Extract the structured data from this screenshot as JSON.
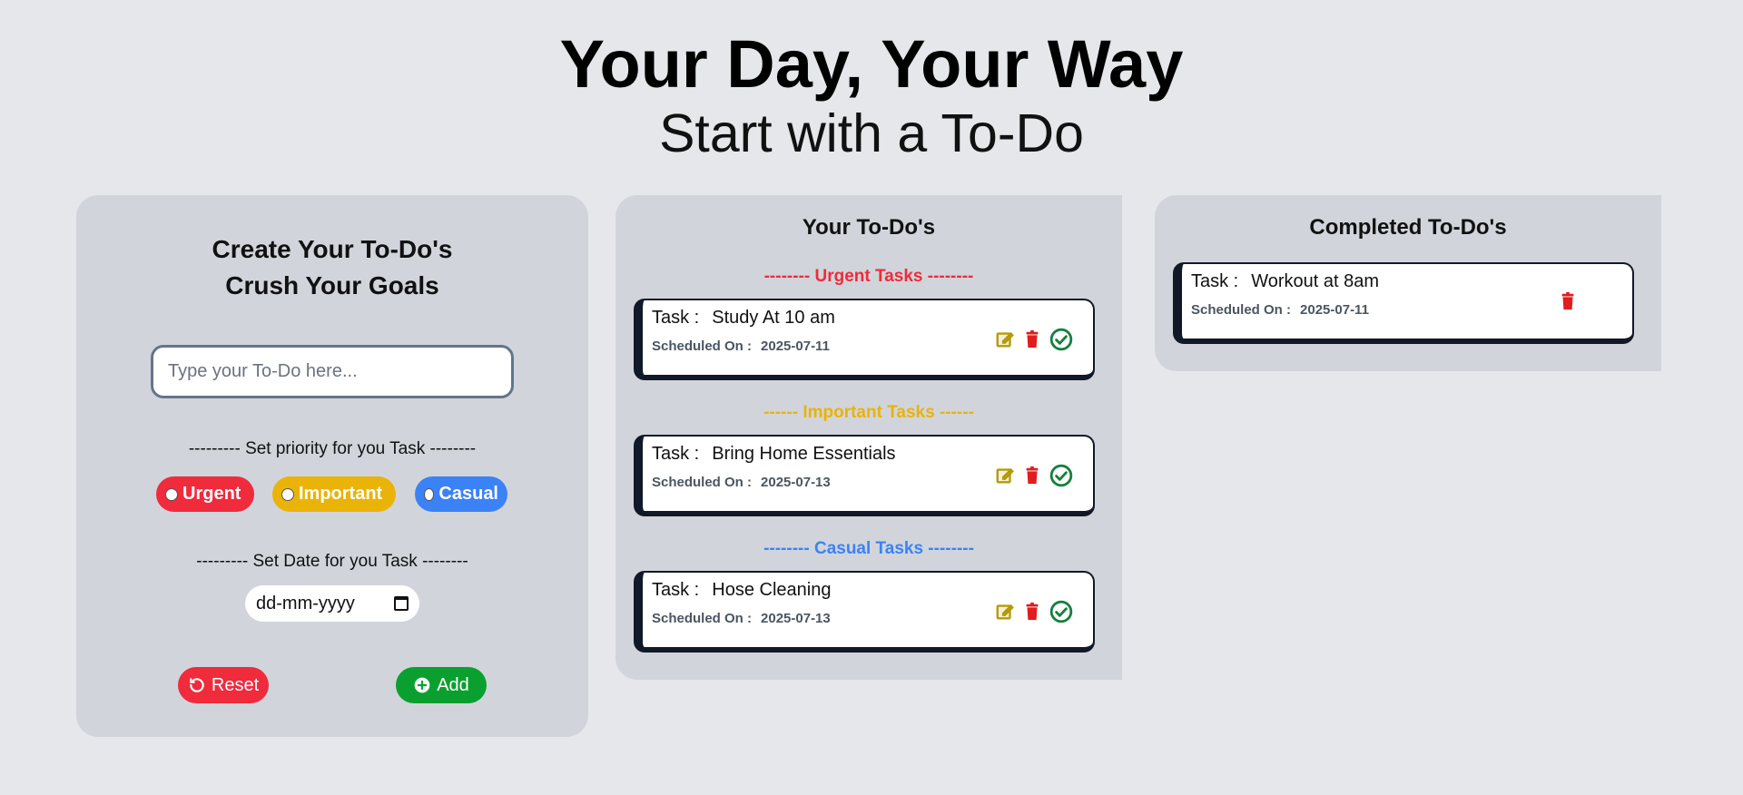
{
  "header": {
    "title": "Your Day, Your Way",
    "subtitle": "Start with a To-Do"
  },
  "create": {
    "heading_line1": "Create Your To-Do's",
    "heading_line2": "Crush Your Goals",
    "input_placeholder": "Type your To-Do here...",
    "priority_label": "--------- Set priority for you Task --------",
    "priorities": [
      "Urgent",
      "Important",
      "Casual"
    ],
    "date_label": "--------- Set Date for you Task --------",
    "date_placeholder": "dd-mm-yyyy",
    "reset_label": "Reset",
    "add_label": "Add"
  },
  "todos": {
    "title": "Your To-Do's",
    "task_label": "Task :",
    "sched_label": "Scheduled On :",
    "urgent_label": "-------- Urgent Tasks --------",
    "important_label": "------ Important Tasks ------",
    "casual_label": "-------- Casual Tasks --------",
    "urgent": [
      {
        "task": "Study At 10 am",
        "date": "2025-07-11"
      }
    ],
    "important": [
      {
        "task": "Bring Home Essentials",
        "date": "2025-07-13"
      }
    ],
    "casual": [
      {
        "task": "Hose Cleaning",
        "date": "2025-07-13"
      }
    ]
  },
  "completed": {
    "title": "Completed To-Do's",
    "items": [
      {
        "task": "Workout at 8am",
        "date": "2025-07-11"
      }
    ]
  },
  "colors": {
    "background": "#e5e7eb",
    "panel": "#d1d5db",
    "urgent": "#ef2b3c",
    "important": "#eab308",
    "casual": "#3b82f6",
    "add": "#0aa02f",
    "edit_icon": "#b59a0a",
    "delete_icon": "#e11d1d",
    "check_icon": "#15803d"
  },
  "icons": {
    "reset": "rotate-ccw-icon",
    "add": "plus-circle-icon",
    "edit": "edit-square-icon",
    "delete": "trash-icon",
    "complete": "check-circle-icon",
    "date": "calendar-icon"
  }
}
